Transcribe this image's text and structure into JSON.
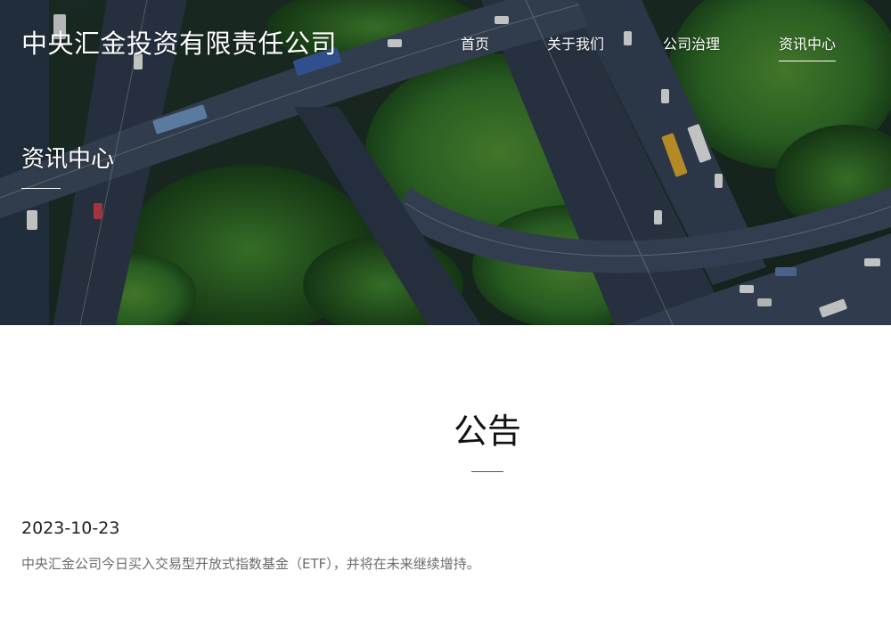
{
  "header": {
    "logo_text": "中央汇金投资有限责任公司",
    "nav": [
      {
        "label": "首页"
      },
      {
        "label": "关于我们"
      },
      {
        "label": "公司治理"
      },
      {
        "label": "资讯中心",
        "active": true
      }
    ]
  },
  "hero": {
    "title": "资讯中心"
  },
  "main": {
    "section_title": "公告",
    "items": [
      {
        "date": "2023-10-23",
        "text": "中央汇金公司今日买入交易型开放式指数基金（ETF），并将在未来继续增持。"
      }
    ]
  },
  "colors": {
    "accent": "#ffffff",
    "text_primary": "#111111",
    "text_secondary": "#6b6b6b"
  }
}
